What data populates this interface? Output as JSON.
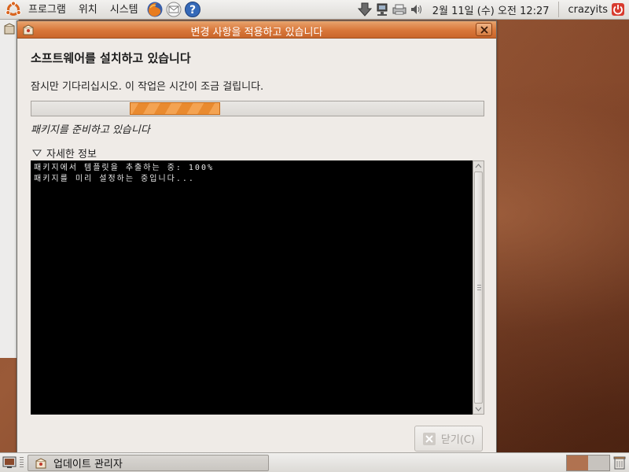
{
  "top_panel": {
    "menus": [
      "프로그램",
      "위치",
      "시스템"
    ],
    "launchers": [
      "firefox-icon",
      "mail-icon",
      "help-icon"
    ],
    "clock": "2월 11일 (수) 오전 12:27",
    "user": "crazyits"
  },
  "dialog": {
    "title": "변경 사항을 적용하고 있습니다",
    "heading": "소프트웨어를 설치하고 있습니다",
    "subtext": "잠시만 기다리십시오. 이 작업은 시간이 조금 걸립니다.",
    "status": "패키지를 준비하고 있습니다",
    "progress_state": "indeterminate",
    "details_label": "자세한 정보",
    "terminal_lines": [
      "패키지에서 템플릿을 추출하는 중: 100%",
      "패키지를 미리 설정하는 중입니다..."
    ],
    "close_label": "닫기(C)"
  },
  "taskbar": {
    "task_label": "업데이트 관리자"
  },
  "colors": {
    "titlebar": "#d9773a",
    "progress_accent": "#e98a2f",
    "terminal_bg": "#000000",
    "terminal_fg": "#e8e8e8"
  }
}
